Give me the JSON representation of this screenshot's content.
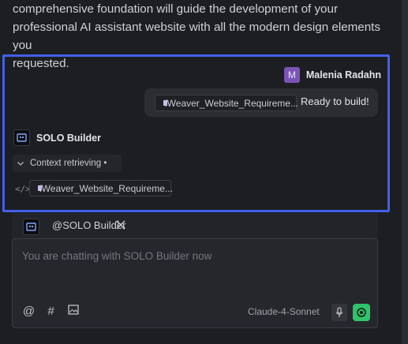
{
  "previous_message": {
    "text": "comprehensive foundation will guide the development of your\nprofessional AI assistant website with all the modern design elements you\nrequested."
  },
  "user_message": {
    "avatar_letter": "M",
    "author": "Malenia Radahn",
    "attachment": "iWeaver_Website_Requireme...",
    "text": "Ready to build!"
  },
  "bot_message": {
    "author": "SOLO Builder",
    "context_label": "Context retrieving •",
    "code_icon": "</>",
    "attachment": "iWeaver_Website_Requireme..."
  },
  "composer": {
    "mention": "@SOLO Builder",
    "placeholder": "You are chatting with SOLO Builder now",
    "model": "Claude-4-Sonnet"
  },
  "colors": {
    "highlight": "#4260e8",
    "send": "#2fc36b",
    "user_avatar": "#7a54b6"
  }
}
